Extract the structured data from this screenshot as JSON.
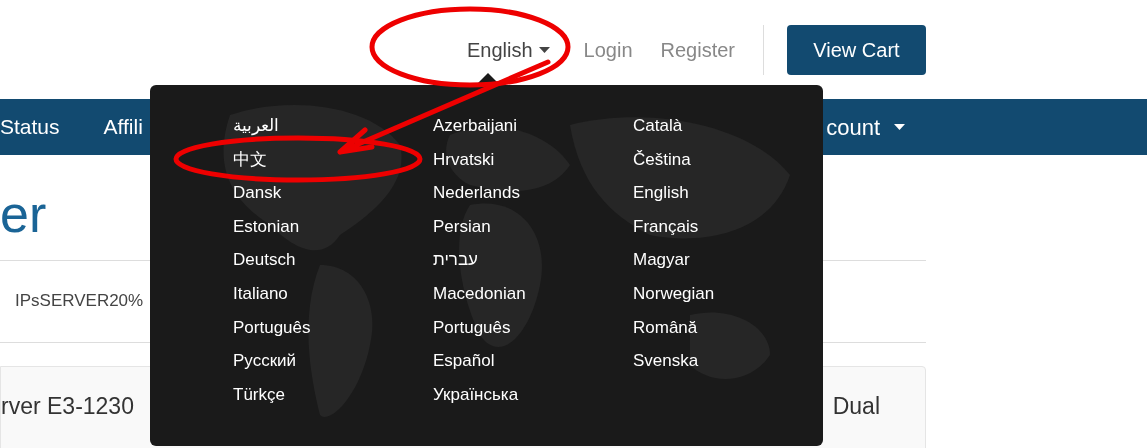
{
  "header": {
    "language_menu": "English",
    "links": [
      "Login",
      "Register"
    ],
    "cart_button": "View Cart"
  },
  "nav": {
    "items": [
      "Status",
      "Affili"
    ],
    "account": "count"
  },
  "page": {
    "heading": "er",
    "promo": "IPsSERVER20%",
    "product_left": "rver E3-1230",
    "product_right": "Dual"
  },
  "language_dropdown": {
    "columns": [
      {
        "items": [
          "العربية",
          "中文",
          "Dansk",
          "Estonian",
          "Deutsch",
          "Italiano",
          "Português",
          "Русский",
          "Türkçe"
        ]
      },
      {
        "items": [
          "Azerbaijani",
          "Hrvatski",
          "Nederlands",
          "Persian",
          "עברית",
          "Macedonian",
          "Português",
          "Español",
          "Українська"
        ]
      },
      {
        "items": [
          "Català",
          "Čeština",
          "English",
          "Français",
          "Magyar",
          "Norwegian",
          "Română",
          "Svenska"
        ]
      }
    ]
  }
}
